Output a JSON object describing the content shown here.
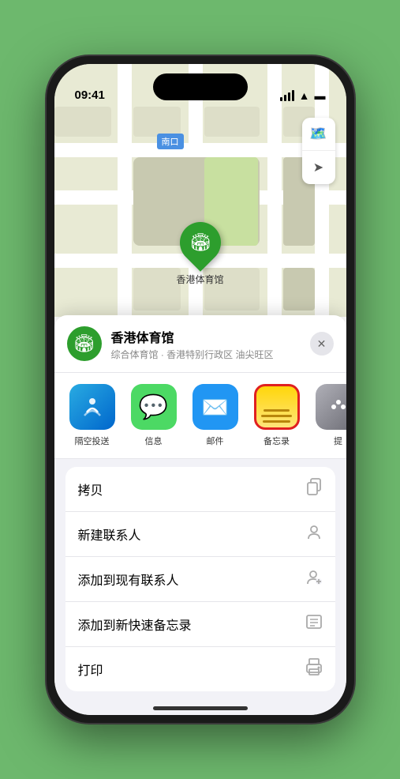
{
  "status_bar": {
    "time": "09:41",
    "signal_label": "signal",
    "wifi_label": "wifi",
    "battery_label": "battery"
  },
  "map": {
    "station_label": "南口",
    "marker_label": "香港体育馆",
    "marker_emoji": "🏟️"
  },
  "location_card": {
    "name": "香港体育馆",
    "subtitle": "综合体育馆 · 香港特别行政区 油尖旺区",
    "close_label": "✕"
  },
  "share_items": [
    {
      "id": "airdrop",
      "label": "隔空投送",
      "icon_type": "airdrop"
    },
    {
      "id": "messages",
      "label": "信息",
      "icon_type": "messages"
    },
    {
      "id": "mail",
      "label": "邮件",
      "icon_type": "mail"
    },
    {
      "id": "notes",
      "label": "备忘录",
      "icon_type": "notes",
      "selected": true
    },
    {
      "id": "more",
      "label": "提",
      "icon_type": "more"
    }
  ],
  "action_items": [
    {
      "id": "copy",
      "label": "拷贝",
      "icon": "📋"
    },
    {
      "id": "new-contact",
      "label": "新建联系人",
      "icon": "👤"
    },
    {
      "id": "add-existing",
      "label": "添加到现有联系人",
      "icon": "👤"
    },
    {
      "id": "add-quick-note",
      "label": "添加到新快速备忘录",
      "icon": "📋"
    },
    {
      "id": "print",
      "label": "打印",
      "icon": "🖨️"
    }
  ]
}
